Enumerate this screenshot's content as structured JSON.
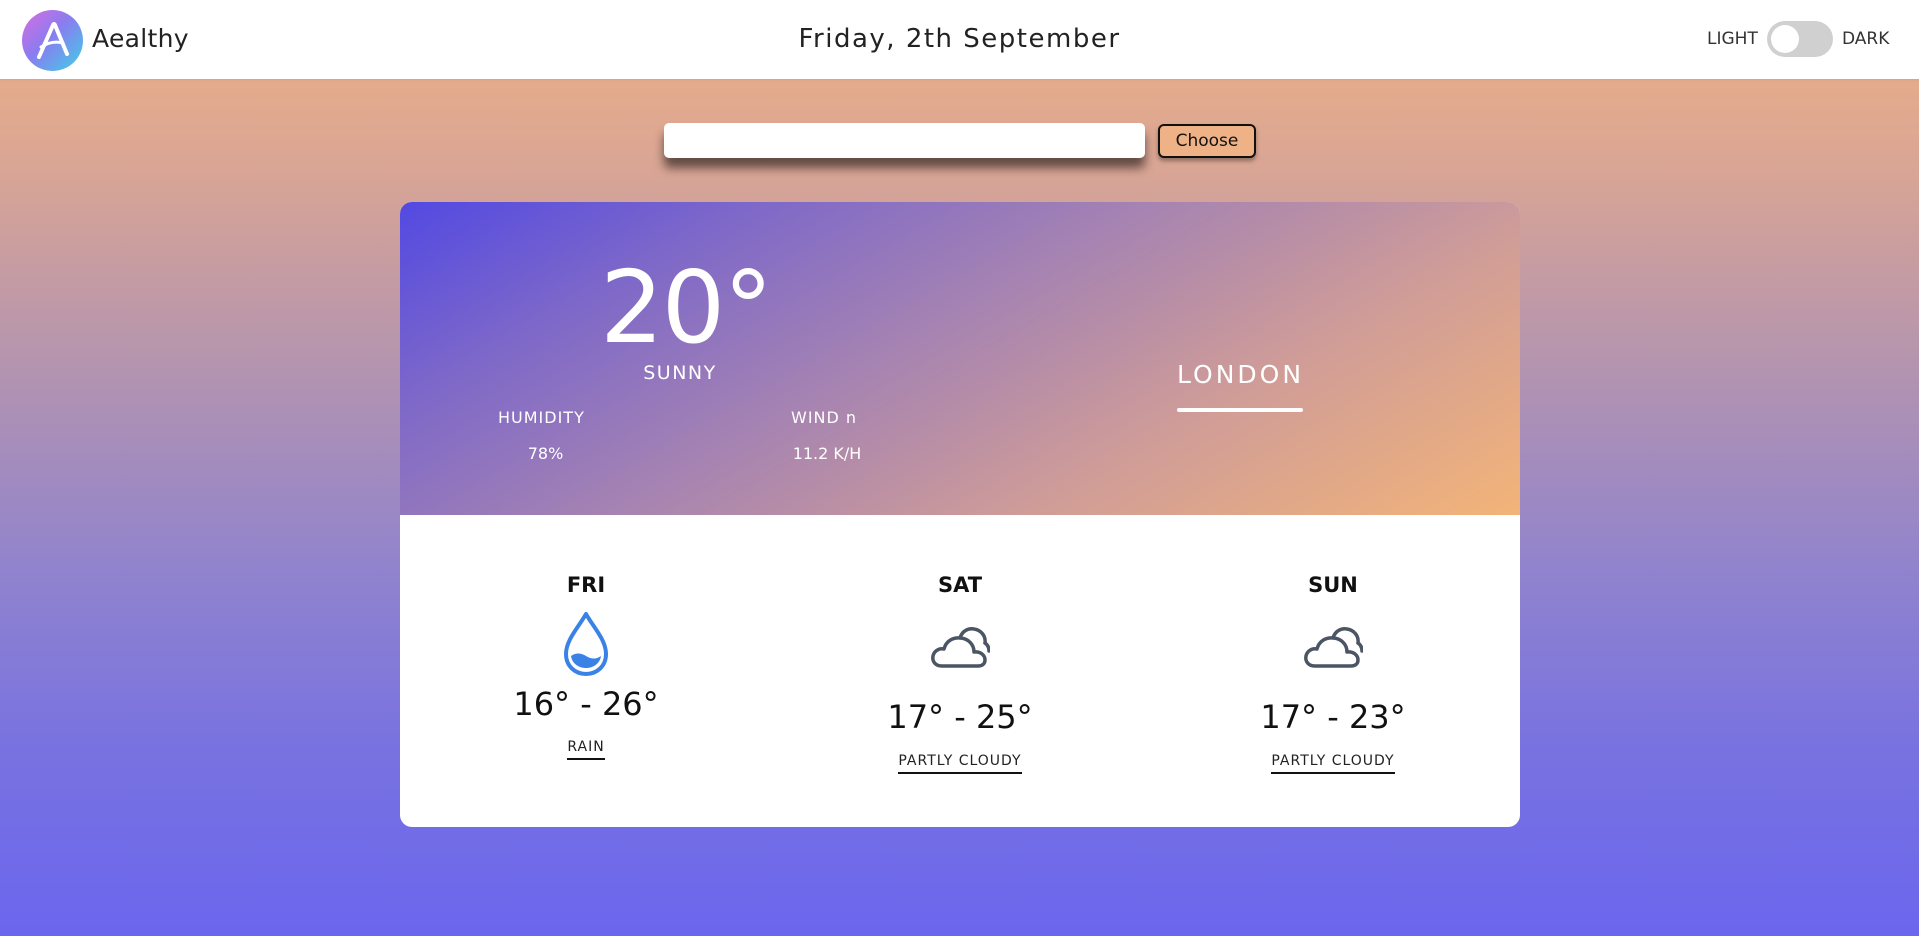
{
  "header": {
    "brand": "Aealthy",
    "date": "Friday, 2th September",
    "theme_light_label": "LIGHT",
    "theme_dark_label": "DARK"
  },
  "search": {
    "value": "",
    "placeholder": "",
    "button_label": "Choose"
  },
  "current": {
    "temperature": "20°",
    "condition": "SUNNY",
    "humidity_label": "HUMIDITY",
    "humidity_value": "78%",
    "wind_label": "WIND n",
    "wind_value": "11.2 K/H",
    "city": "LONDON"
  },
  "forecast": [
    {
      "day": "FRI",
      "range": "16° - 26°",
      "description": "RAIN",
      "icon": "raindrop-icon"
    },
    {
      "day": "SAT",
      "range": "17° - 25°",
      "description": "PARTLY CLOUDY",
      "icon": "cloud-icon"
    },
    {
      "day": "SUN",
      "range": "17° - 23°",
      "description": "PARTLY CLOUDY",
      "icon": "cloud-icon"
    }
  ],
  "colors": {
    "rain_icon": "#3b82e6",
    "cloud_icon": "#4b5563",
    "choose_button": "#efb286"
  }
}
